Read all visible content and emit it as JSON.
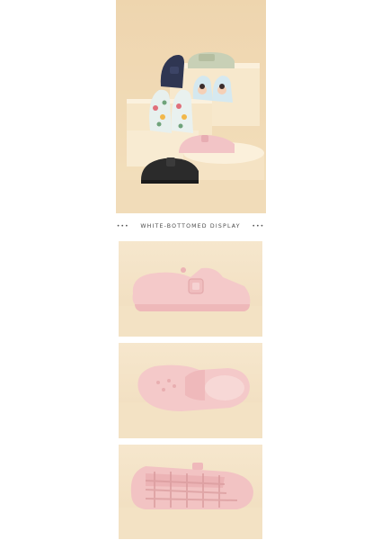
{
  "display_heading": {
    "left_dots": "•••",
    "text": "WHITE-BOTTOMED DISPLAY",
    "right_dots": "•••"
  },
  "colors": {
    "background_beige": "#f3dfbd",
    "podium_cream": "#f8ebd1",
    "clog_pink": "#f4c6c4",
    "clog_black": "#2b2b2b",
    "clog_navy": "#2e3550",
    "clog_sage": "#c7cfb4"
  },
  "photos": [
    {
      "name": "lineup-photo",
      "subject": "assorted clogs on podiums"
    },
    {
      "name": "side-view-photo",
      "subject": "pink clog side view"
    },
    {
      "name": "top-view-photo",
      "subject": "pink clog top view"
    },
    {
      "name": "sole-view-photo",
      "subject": "pink clog sole tread"
    }
  ]
}
